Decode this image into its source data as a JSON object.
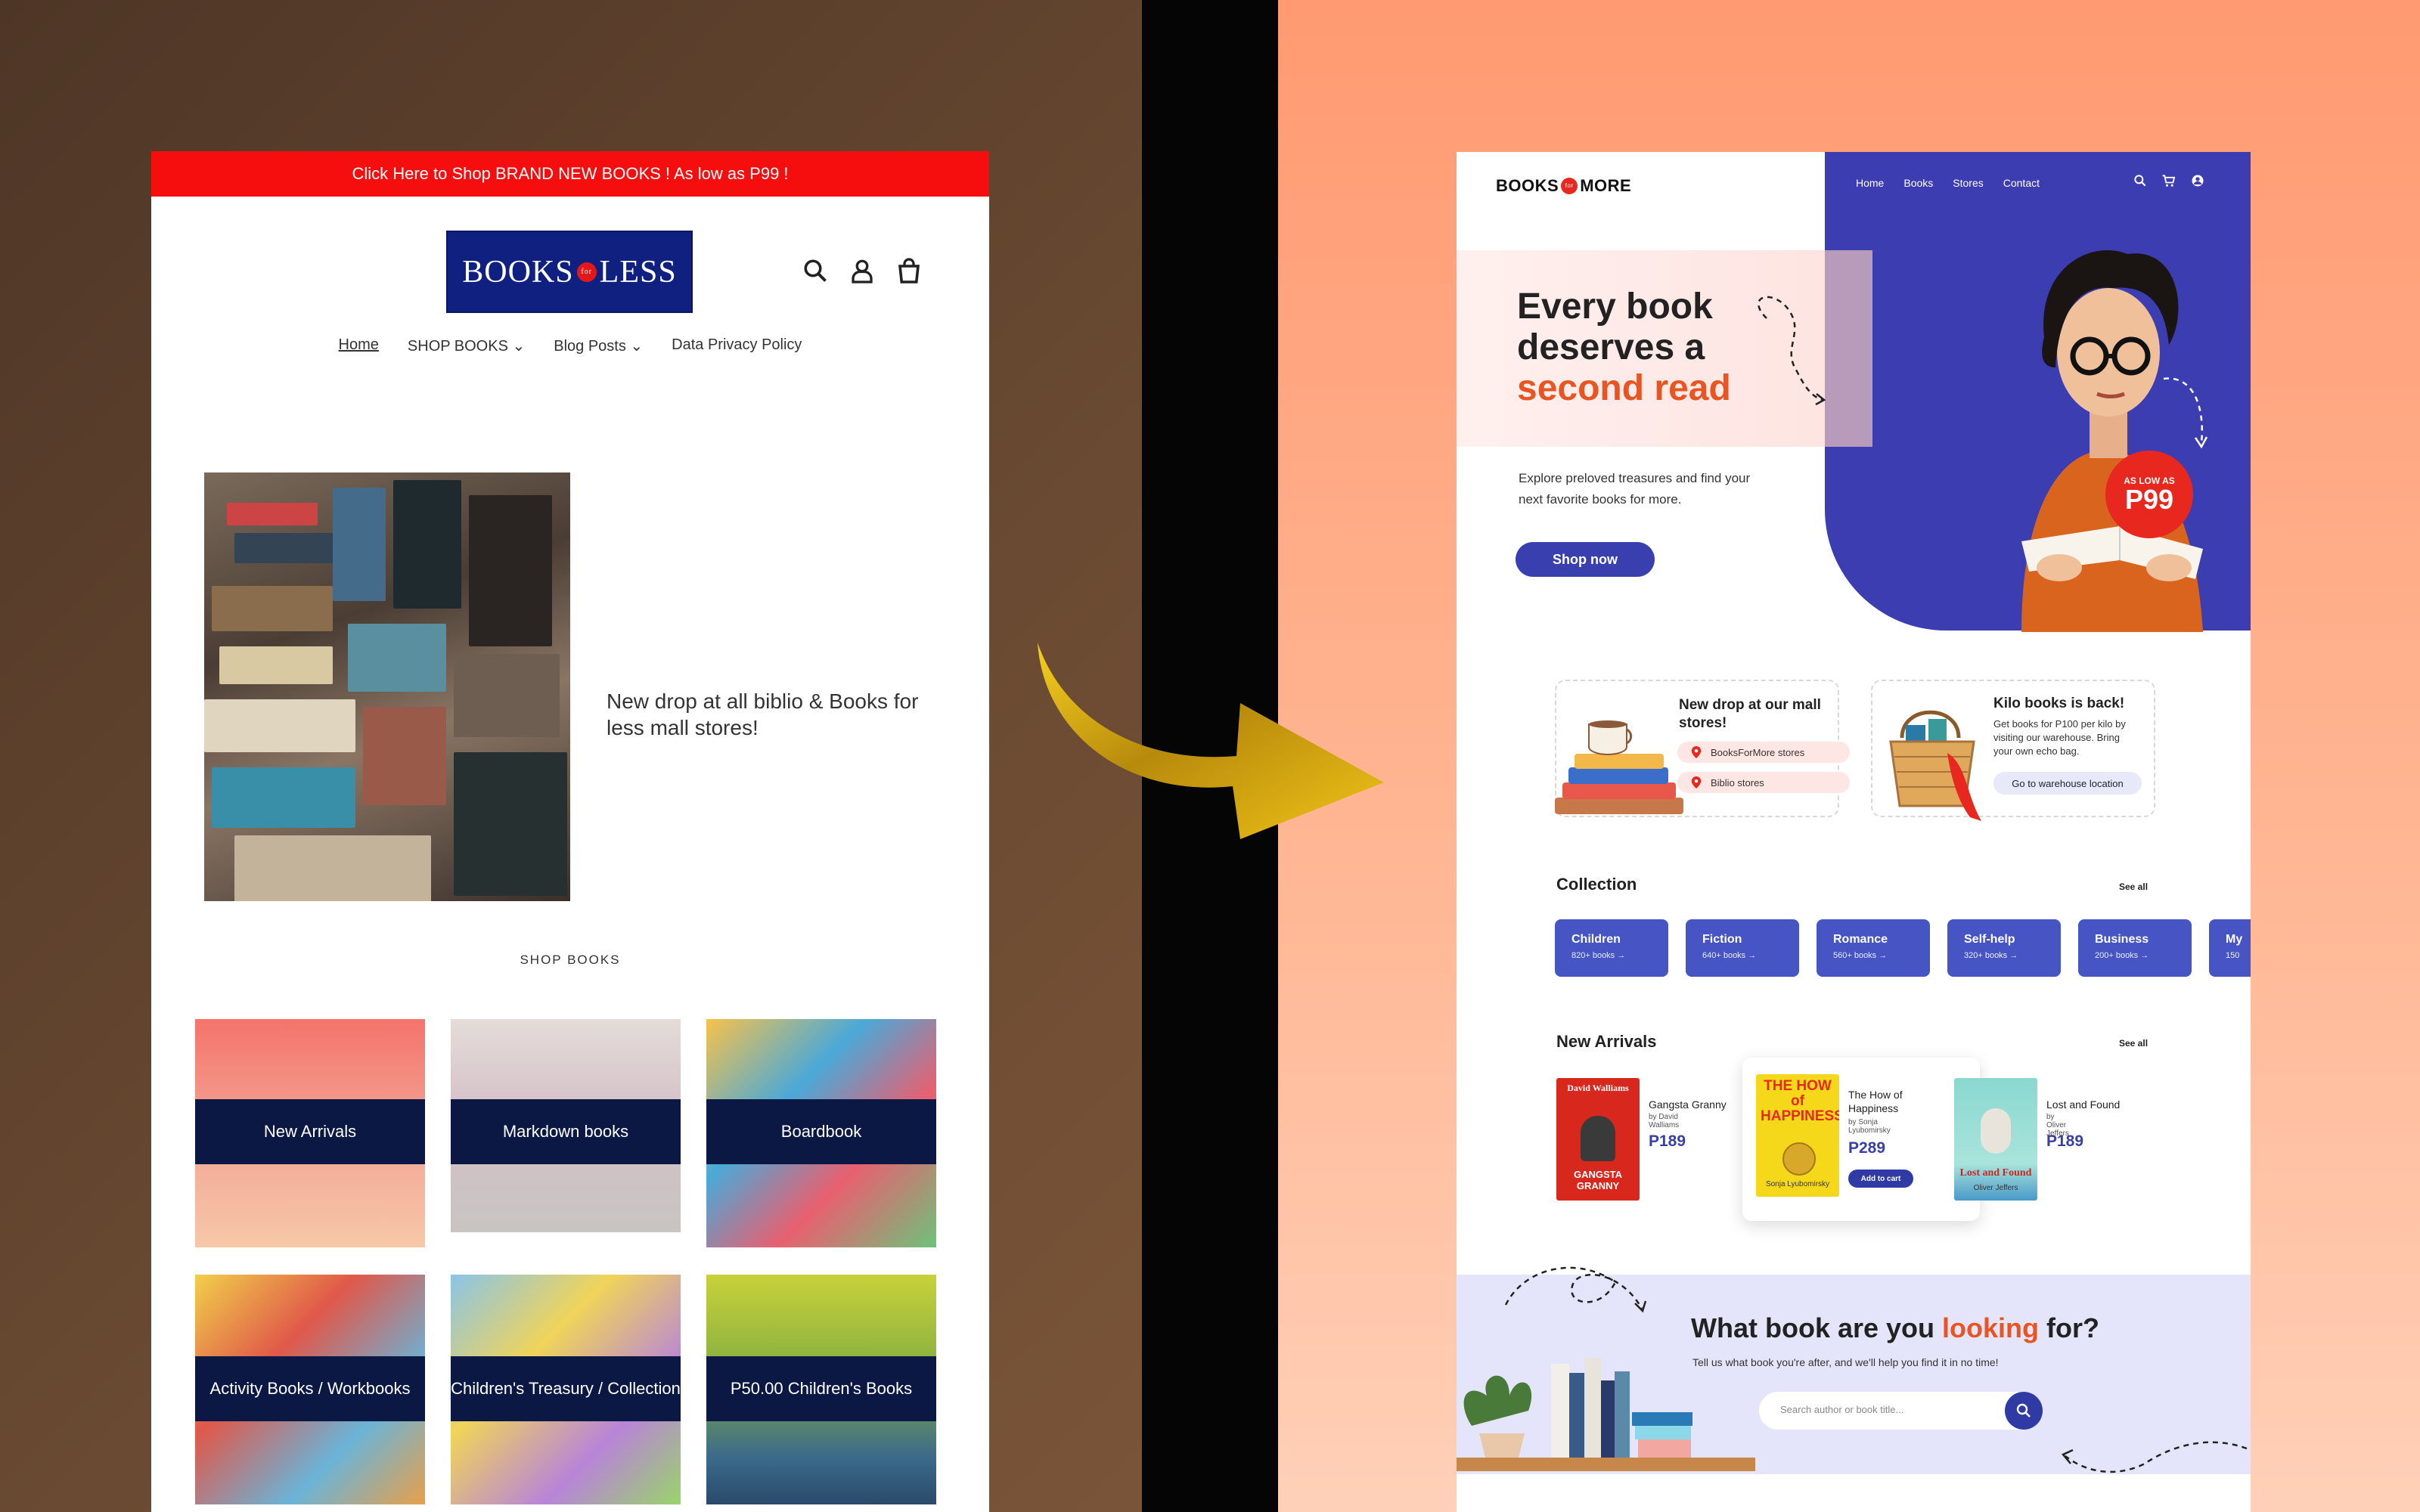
{
  "old_site": {
    "promo_banner": "Click Here to Shop BRAND NEW BOOKS ! As low as P99 !",
    "logo": {
      "left": "BOOKS",
      "mid": "for",
      "right": "LESS"
    },
    "nav": [
      "Home",
      "SHOP BOOKS ⌄",
      "Blog Posts ⌄",
      "Data Privacy Policy"
    ],
    "hero_text": "New drop at all biblio & Books for less mall stores!",
    "shop_title": "SHOP BOOKS",
    "tiles": [
      "New Arrivals",
      "Markdown books",
      "Boardbook",
      "Activity Books / Workbooks",
      "Children's Treasury / Collection",
      "P50.00 Children's Books"
    ]
  },
  "new_site": {
    "brand": {
      "left": "BOOKS",
      "mid": "for",
      "right": "MORE"
    },
    "nav": [
      "Home",
      "Books",
      "Stores",
      "Contact"
    ],
    "headline": {
      "line1": "Every book",
      "line2": "deserves a",
      "accent": "second read"
    },
    "subtext": "Explore preloved treasures and find your next favorite books for more.",
    "shop_button": "Shop now",
    "badge": {
      "small": "AS LOW AS",
      "big": "P99"
    },
    "card1": {
      "title": "New drop at our mall stores!",
      "stores": [
        "BooksForMore stores",
        "Biblio stores"
      ]
    },
    "card2": {
      "title": "Kilo books is back!",
      "desc": "Get books for P100 per kilo by visiting our warehouse. Bring your own echo bag.",
      "button": "Go to warehouse location"
    },
    "collection": {
      "title": "Collection",
      "see_all": "See all",
      "items": [
        {
          "name": "Children",
          "count": "820+ books →"
        },
        {
          "name": "Fiction",
          "count": "640+ books →"
        },
        {
          "name": "Romance",
          "count": "560+ books →"
        },
        {
          "name": "Self-help",
          "count": "320+ books →"
        },
        {
          "name": "Business",
          "count": "200+ books →"
        },
        {
          "name": "My",
          "count": "150"
        }
      ]
    },
    "new_arrivals": {
      "title": "New Arrivals",
      "see_all": "See all",
      "items": [
        {
          "title": "Gangsta Granny",
          "author": "by David Walliams",
          "price": "P189",
          "cover_top": "David Walliams",
          "cover_bottom": "GANGSTA GRANNY"
        },
        {
          "title": "The How of Happiness",
          "author": "by Sonja Lyubomirsky",
          "price": "P289",
          "button": "Add to cart",
          "cover_top": "THE HOW of HAPPINESS",
          "cover_bottom": "Sonja Lyubomirsky"
        },
        {
          "title": "Lost and Found",
          "author": "by Oliver Jeffers",
          "price": "P189",
          "cover_top": "Lost and Found",
          "cover_bottom": "Oliver Jeffers"
        }
      ]
    },
    "search": {
      "question": "What book are you ",
      "question_accent": "looking",
      "question_end": " for?",
      "subtext": "Tell us what book you're after, and we'll help you find it in no time!",
      "placeholder": "Search author or book title..."
    }
  },
  "colors": {
    "old_promo": "#f60d0d",
    "old_logo_bg": "#102080",
    "new_blue": "#3c3db0",
    "accent_orange": "#e85422",
    "badge_red": "#e8281e"
  }
}
